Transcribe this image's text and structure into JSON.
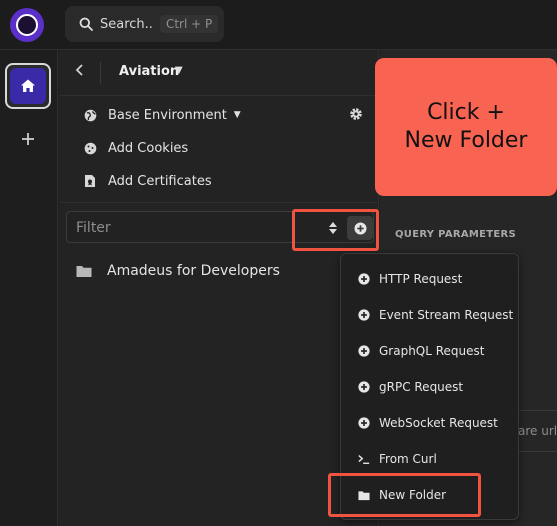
{
  "search": {
    "label": "Search..",
    "shortcut": "Ctrl + P"
  },
  "workspace": {
    "title": "Aviation"
  },
  "sidebar": {
    "environment": "Base Environment",
    "cookies": "Add Cookies",
    "certificates": "Add Certificates",
    "filter_placeholder": "Filter",
    "folders": [
      {
        "name": "Amadeus for Developers"
      }
    ]
  },
  "right": {
    "query_parameters_label": "QUERY PARAMETERS",
    "url_fragment": "are url"
  },
  "menu": {
    "items": [
      {
        "label": "HTTP Request",
        "icon": "plus-circle-icon"
      },
      {
        "label": "Event Stream Request",
        "icon": "plus-circle-icon"
      },
      {
        "label": "GraphQL Request",
        "icon": "plus-circle-icon"
      },
      {
        "label": "gRPC Request",
        "icon": "plus-circle-icon"
      },
      {
        "label": "WebSocket Request",
        "icon": "plus-circle-icon"
      },
      {
        "label": "From Curl",
        "icon": "terminal-icon"
      },
      {
        "label": "New Folder",
        "icon": "folder-icon"
      }
    ]
  },
  "callout": {
    "line1": "Click +",
    "line2": "New Folder"
  },
  "colors": {
    "accent": "#5b2fc9",
    "highlight": "#f0533f",
    "callout_bg": "#f96352"
  }
}
